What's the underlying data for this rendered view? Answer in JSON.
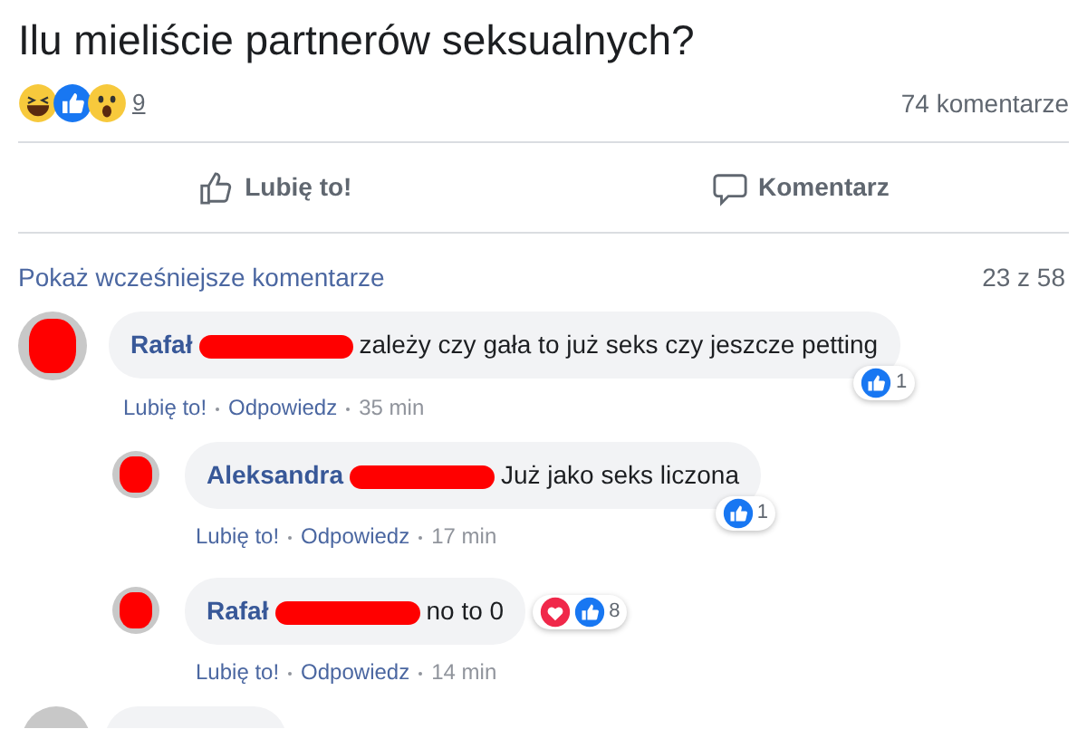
{
  "post": {
    "title": "Ilu mieliście partnerów seksualnych?",
    "reactions": [
      {
        "kind": "haha"
      },
      {
        "kind": "like"
      },
      {
        "kind": "wow"
      }
    ],
    "reaction_count": "9",
    "comment_count": "74 komentarze"
  },
  "actions": [
    {
      "kind": "like",
      "label": "Lubię to!"
    },
    {
      "kind": "comment",
      "label": "Komentarz"
    }
  ],
  "comments_header": {
    "link": "Pokaż wcześniejsze komentarze",
    "position": "23 z 58"
  },
  "comments": [
    {
      "author": "Rafał",
      "text": "zależy czy gała to już seks czy jeszcze petting",
      "reactions": [
        {
          "kind": "like"
        }
      ],
      "reaction_count": "1",
      "like": "Lubię to!",
      "reply": "Odpowiedz",
      "time": "35 min",
      "children": [
        {
          "author": "Aleksandra",
          "text": "Już jako seks liczona",
          "reactions": [
            {
              "kind": "like"
            }
          ],
          "reaction_count": "1",
          "like": "Lubię to!",
          "reply": "Odpowiedz",
          "time": "17 min"
        },
        {
          "author": "Rafał",
          "text": "no to 0",
          "reactions": [
            {
              "kind": "love"
            },
            {
              "kind": "like"
            }
          ],
          "reaction_count": "8",
          "like": "Lubię to!",
          "reply": "Odpowiedz",
          "time": "14 min"
        }
      ]
    }
  ]
}
